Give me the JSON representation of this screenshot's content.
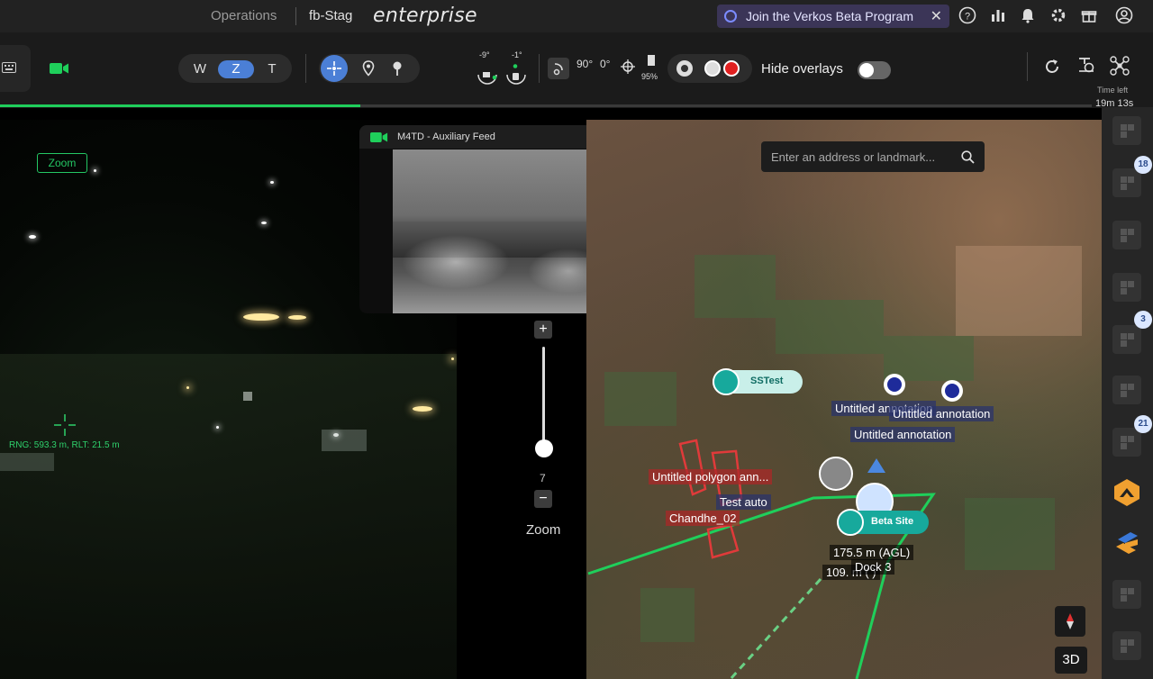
{
  "header": {
    "nav_label": "Operations",
    "org_label": "fb-Stag",
    "brand": "enterprise",
    "beta_banner": "Join the Verkos Beta Program",
    "beta_close": "✕"
  },
  "toolbar": {
    "modes": [
      "W",
      "Z",
      "T"
    ],
    "active_mode": "Z",
    "gimbal_pitch": "-9°",
    "gimbal_roll": "-1°",
    "angle_90": "90°",
    "angle_0": "0°",
    "battery": "95%",
    "hide_overlays_label": "Hide overlays",
    "time_left_label": "Time left",
    "time_left_value": "19m 13s",
    "flight_progress": 0.33
  },
  "camera": {
    "zoom_tag": "Zoom",
    "rng_readout": "RNG: 593.3 m, RLT: 21.5 m"
  },
  "aux_feed": {
    "title": "M4TD - Auxiliary Feed"
  },
  "zoom_control": {
    "plus": "+",
    "minus": "−",
    "value": "7",
    "label": "Zoom"
  },
  "map": {
    "search_placeholder": "Enter an address or landmark...",
    "labels": {
      "sstest": "SSTest",
      "untitled_annotation_1": "Untitled annotation",
      "untitled_annotation_2": "Untitled annotation",
      "untitled_annotation_3": "Untitled annotation",
      "untitled_polygon": "Untitled polygon ann...",
      "test_auto": "Test auto",
      "chandhe": "Chandhe_02",
      "beta_site": "Beta Site",
      "agl": "175.5 m (AGL)",
      "dock": "Dock 3",
      "alt_partial": "109.  m (    )"
    },
    "btn_3d": "3D"
  },
  "sidebar": {
    "badges": [
      "18",
      "3",
      "21"
    ]
  },
  "colors": {
    "accent_green": "#1fcf5b",
    "active_blue": "#4b7fd6",
    "teal": "#17a99c",
    "orange": "#f0a030"
  }
}
